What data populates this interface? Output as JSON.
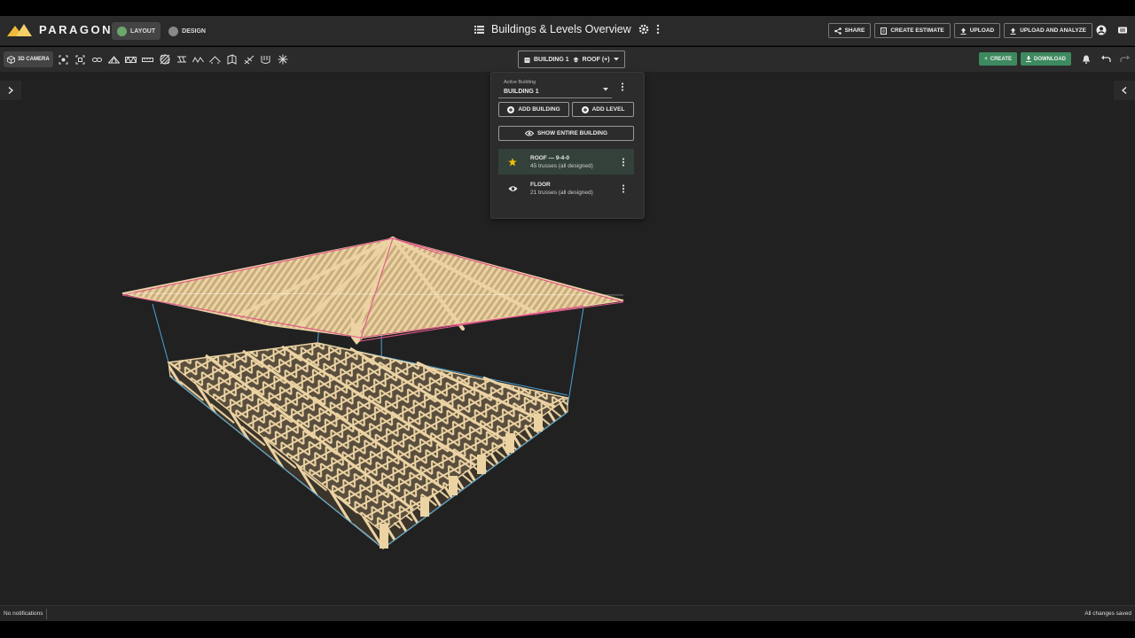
{
  "app": {
    "logo": "PARAGON",
    "title": "Buildings & Levels Overview",
    "mode_tabs": [
      {
        "label": "LAYOUT",
        "active": true
      },
      {
        "label": "DESIGN",
        "active": false
      }
    ],
    "top_buttons": [
      {
        "label": "SHARE",
        "icon": "share-icon"
      },
      {
        "label": "CREATE ESTIMATE",
        "icon": "document-icon"
      },
      {
        "label": "UPLOAD",
        "icon": "upload-icon"
      },
      {
        "label": "UPLOAD AND ANALYZE",
        "icon": "upload-icon"
      }
    ]
  },
  "toolbar": {
    "camera_label": "3D CAMERA",
    "building_dropdown": {
      "building": "BUILDING 1",
      "level": "ROOF (+)"
    },
    "create_label": "CREATE",
    "download_label": "DOWNLOAD"
  },
  "panel": {
    "active_building_label": "Active Building",
    "active_building_value": "BUILDING 1",
    "add_building_label": "ADD BUILDING",
    "add_level_label": "ADD LEVEL",
    "show_entire_label": "SHOW ENTIRE BUILDING",
    "levels": [
      {
        "name": "ROOF — 9-4-0",
        "detail": "45 trusses (all designed)",
        "icon": "star-icon",
        "active": true
      },
      {
        "name": "FLOOR",
        "detail": "21 trusses (all designed)",
        "icon": "eye-icon",
        "active": false
      }
    ]
  },
  "status": {
    "left": "No notifications",
    "right": "All changes saved"
  },
  "colors": {
    "accent_green": "#3d8a5e",
    "star_yellow": "#f0c000",
    "wood": "#ecd3a3",
    "edge_blue": "#4aa3d8",
    "roof_pink": "#e0568a"
  }
}
